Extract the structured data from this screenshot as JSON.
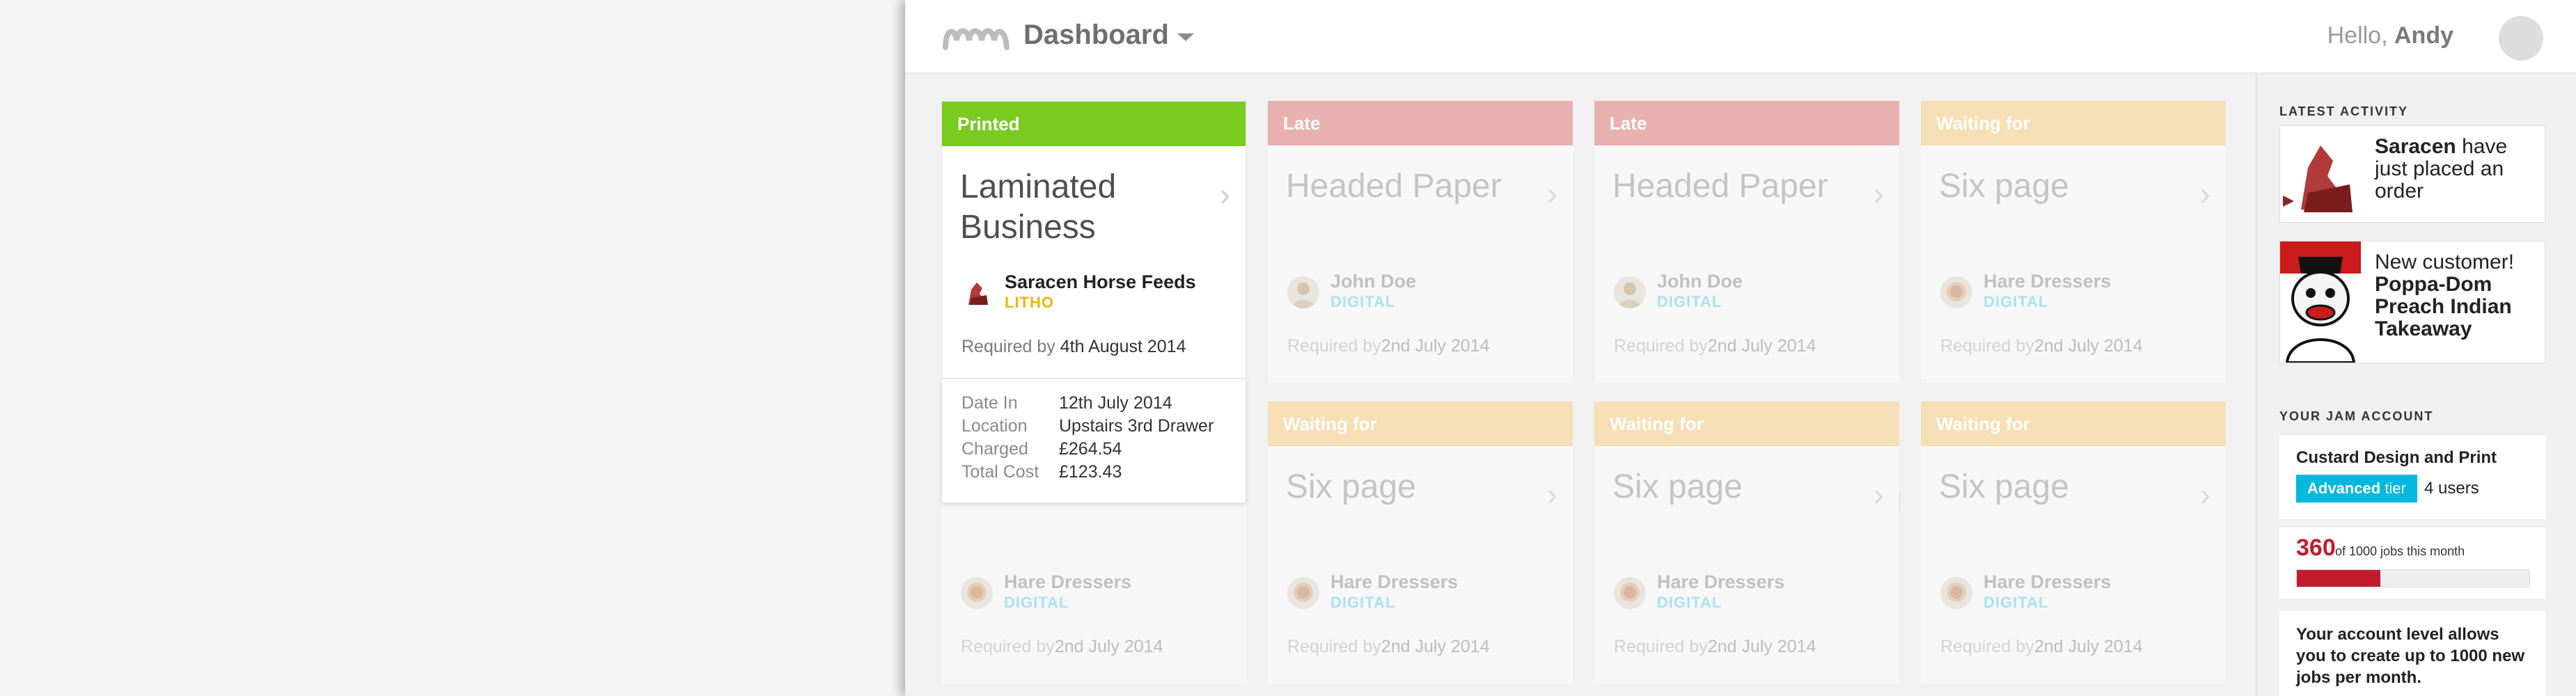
{
  "header": {
    "title": "Dashboard",
    "greeting_prefix": "Hello,",
    "user_name": "Andy",
    "logo_icon": "jam-wave-logo-icon",
    "avatar_icon": "user-avatar-icon"
  },
  "jobs": [
    {
      "status": "Printed",
      "status_color": "#79cb1f",
      "title_line1": "Laminated",
      "title_line2": "Business",
      "customer": "Saracen Horse Feeds",
      "type": "LITHO",
      "required_label": "Required by",
      "required_date": "4th August 2014"
    },
    {
      "status": "Late",
      "status_color": "#e9b0b0",
      "title_line1": "Headed Paper",
      "customer": "John Doe",
      "type": "DIGITAL",
      "required_label": "Required by",
      "required_date": "2nd July 2014"
    },
    {
      "status": "Late",
      "status_color": "#e9b0b0",
      "title_line1": "Headed Paper",
      "customer": "John Doe",
      "type": "DIGITAL",
      "required_label": "Required by",
      "required_date": "2nd July 2014"
    },
    {
      "status": "Waiting for",
      "status_color": "#f6dfb4",
      "title_line1": "Six page",
      "customer": "Hare Dressers",
      "type": "DIGITAL",
      "required_label": "Required by",
      "required_date": "2nd July 2014"
    },
    {
      "status": "",
      "title_line1": "",
      "customer": "Hare Dressers",
      "type": "DIGITAL",
      "required_label": "Required by",
      "required_date": "2nd July 2014"
    },
    {
      "status": "Waiting for",
      "status_color": "#f6dfb4",
      "title_line1": "Six page",
      "customer": "Hare Dressers",
      "type": "DIGITAL",
      "required_label": "Required by",
      "required_date": "2nd July 2014"
    },
    {
      "status": "Waiting for",
      "status_color": "#f6dfb4",
      "title_line1": "Six page",
      "customer": "Hare Dressers",
      "type": "DIGITAL",
      "required_label": "Required by",
      "required_date": "2nd July 2014"
    },
    {
      "status": "Waiting for",
      "status_color": "#f6dfb4",
      "title_line1": "Six page",
      "customer": "Hare Dressers",
      "type": "DIGITAL",
      "required_label": "Required by",
      "required_date": "2nd July 2014"
    }
  ],
  "ghost_title_fragment": "pag",
  "job_details": {
    "rows": [
      {
        "label": "Date In",
        "value": "12th July 2014"
      },
      {
        "label": "Location",
        "value": "Upstairs 3rd Drawer"
      },
      {
        "label": "Charged",
        "value": "£264.54"
      },
      {
        "label": "Total Cost",
        "value": "£123.43"
      }
    ]
  },
  "latest_activity": {
    "heading": "LATEST ACTIVITY",
    "items": [
      {
        "bold": "Saracen",
        "text": " have just placed an order"
      },
      {
        "prefix": "New customer!",
        "bold": "Poppa-Dom Preach Indian Takeaway"
      }
    ]
  },
  "account": {
    "heading": "YOUR JAM ACCOUNT",
    "name": "Custard Design and Print",
    "tier_name": "Advanced",
    "tier_word": "tier",
    "users": "4 users",
    "jobs_used": "360",
    "jobs_text": "of 1000 jobs this month",
    "jobs_fraction": 0.36,
    "allowance": "Your account level allows you to create up to 1000 new jobs per month."
  }
}
